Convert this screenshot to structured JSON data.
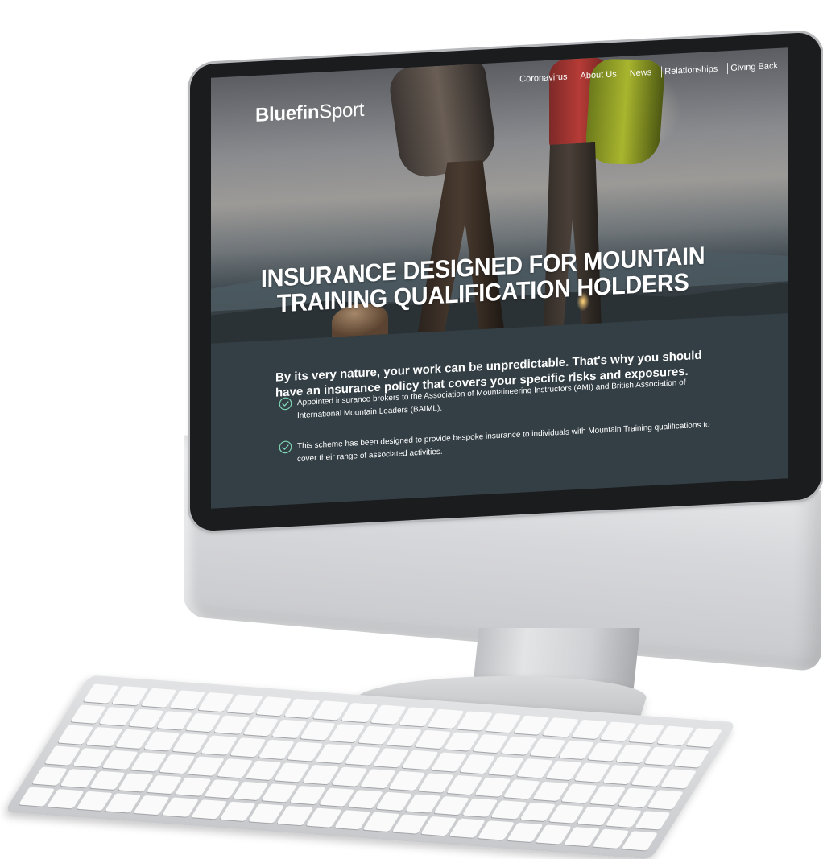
{
  "site": {
    "logo_bold": "Bluefin",
    "logo_light": "Sport"
  },
  "nav": {
    "items": [
      {
        "label": "Coronavirus"
      },
      {
        "label": "About Us"
      },
      {
        "label": "News"
      },
      {
        "label": "Relationships"
      },
      {
        "label": "Giving Back"
      }
    ]
  },
  "hero": {
    "headline_line1": "INSURANCE DESIGNED FOR MOUNTAIN",
    "headline_line2": "TRAINING QUALIFICATION HOLDERS"
  },
  "content": {
    "intro": "By its very nature, your work can be unpredictable. That's why you should have an insurance policy that covers your specific risks and exposures.",
    "points": [
      {
        "text": "Appointed insurance brokers to the Association of Mountaineering Instructors (AMI) and British Association of International Mountain Leaders (BAIML)."
      },
      {
        "text": "This scheme has been designed to provide bespoke insurance to individuals with Mountain Training qualifications to cover their range of associated activities."
      }
    ]
  },
  "colors": {
    "panel_bg": "#333f45",
    "check_accent": "#7fd6b5",
    "text": "#ffffff"
  },
  "icons": {
    "check": "check-circle-icon"
  }
}
